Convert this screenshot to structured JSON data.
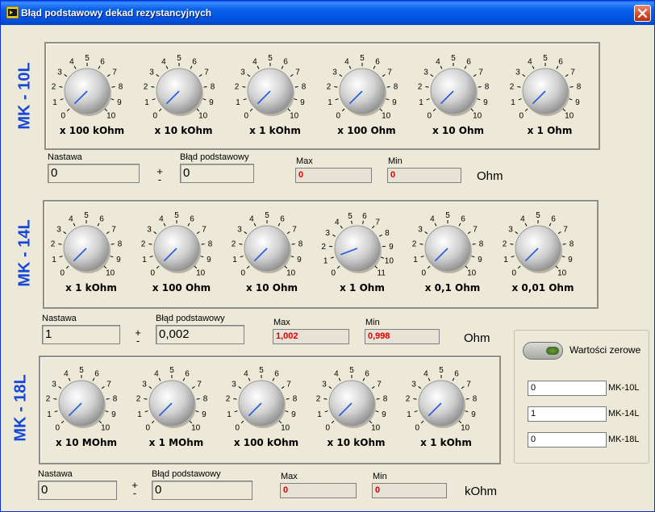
{
  "window": {
    "title": "Błąd podstawowy dekad rezystancyjnych",
    "close_label": "✕"
  },
  "sections": [
    {
      "label": "MK - 10L",
      "knobs": [
        {
          "multiplier": "x 100 kOhm",
          "max": 10,
          "value": 0
        },
        {
          "multiplier": "x 10 kOhm",
          "max": 10,
          "value": 0
        },
        {
          "multiplier": "x 1 kOhm",
          "max": 10,
          "value": 0
        },
        {
          "multiplier": "x 100 Ohm",
          "max": 10,
          "value": 0
        },
        {
          "multiplier": "x 10 Ohm",
          "max": 10,
          "value": 0
        },
        {
          "multiplier": "x 1 Ohm",
          "max": 10,
          "value": 0
        }
      ],
      "nastawa_label": "Nastawa",
      "nastawa_value": "0",
      "blad_label": "Błąd podstawowy",
      "blad_value": "0",
      "max_label": "Max",
      "max_value": "0",
      "min_label": "Min",
      "min_value": "0",
      "unit": "Ohm"
    },
    {
      "label": "MK - 14L",
      "knobs": [
        {
          "multiplier": "x 1 kOhm",
          "max": 10,
          "value": 0
        },
        {
          "multiplier": "x 100 Ohm",
          "max": 10,
          "value": 0
        },
        {
          "multiplier": "x 10 Ohm",
          "max": 10,
          "value": 0
        },
        {
          "multiplier": "x 1 Ohm",
          "max": 11,
          "value": 1
        },
        {
          "multiplier": "x 0,1 Ohm",
          "max": 10,
          "value": 0
        },
        {
          "multiplier": "x 0,01 Ohm",
          "max": 10,
          "value": 0
        }
      ],
      "nastawa_label": "Nastawa",
      "nastawa_value": "1",
      "blad_label": "Błąd podstawowy",
      "blad_value": "0,002",
      "max_label": "Max",
      "max_value": "1,002",
      "min_label": "Min",
      "min_value": "0,998",
      "unit": "Ohm"
    },
    {
      "label": "MK - 18L",
      "knobs": [
        {
          "multiplier": "x 10 MOhm",
          "max": 10,
          "value": 0
        },
        {
          "multiplier": "x 1 MOhm",
          "max": 10,
          "value": 0
        },
        {
          "multiplier": "x 100 kOhm",
          "max": 10,
          "value": 0
        },
        {
          "multiplier": "x 10 kOhm",
          "max": 10,
          "value": 0
        },
        {
          "multiplier": "x 1 kOhm",
          "max": 10,
          "value": 0
        }
      ],
      "nastawa_label": "Nastawa",
      "nastawa_value": "0",
      "blad_label": "Błąd podstawowy",
      "blad_value": "0",
      "max_label": "Max",
      "max_value": "0",
      "min_label": "Min",
      "min_value": "0",
      "unit": "kOhm"
    }
  ],
  "plus_minus": {
    "plus": "+",
    "minus": "-"
  },
  "zero_panel": {
    "button_label": "Wartości zerowe",
    "fields": [
      {
        "value": "0",
        "label": "MK-10L"
      },
      {
        "value": "1",
        "label": "MK-14L"
      },
      {
        "value": "0",
        "label": "MK-18L"
      }
    ]
  },
  "colors": {
    "section_label": "#1747d8",
    "readout_red": "#e00000",
    "knob_pointer": "#1e5ae0"
  }
}
